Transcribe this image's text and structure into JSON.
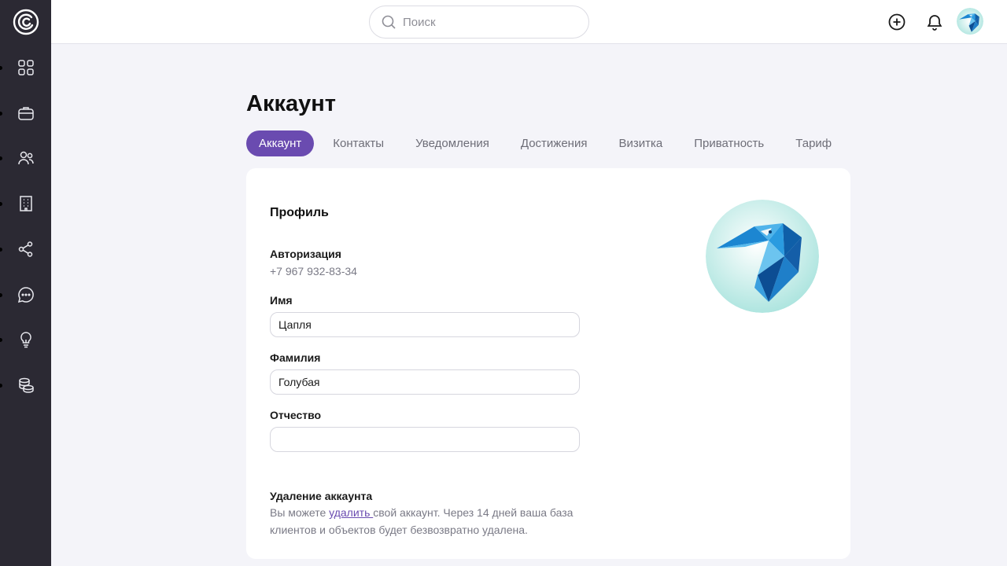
{
  "search": {
    "placeholder": "Поиск"
  },
  "page": {
    "title": "Аккаунт"
  },
  "tabs": [
    {
      "label": "Аккаунт",
      "active": true
    },
    {
      "label": "Контакты"
    },
    {
      "label": "Уведомления"
    },
    {
      "label": "Достижения"
    },
    {
      "label": "Визитка"
    },
    {
      "label": "Приватность"
    },
    {
      "label": "Тариф"
    }
  ],
  "sidebar": {
    "items": [
      {
        "icon": "grid-icon"
      },
      {
        "icon": "briefcase-icon"
      },
      {
        "icon": "users-icon"
      },
      {
        "icon": "building-icon"
      },
      {
        "icon": "share-icon"
      },
      {
        "icon": "chat-icon"
      },
      {
        "icon": "lightbulb-icon"
      },
      {
        "icon": "coins-icon"
      }
    ]
  },
  "profile": {
    "section_title": "Профиль",
    "auth_label": "Авторизация",
    "auth_value": "+7 967 932-83-34",
    "first_name_label": "Имя",
    "first_name_value": "Цапля",
    "last_name_label": "Фамилия",
    "last_name_value": "Голубая",
    "middle_name_label": "Отчество",
    "middle_name_value": ""
  },
  "deletion": {
    "title": "Удаление аккаунта",
    "text_before": "Вы можете ",
    "link": "удалить ",
    "text_after": "свой аккаунт. Через 14 дней ваша база клиентов и объектов будет безвозвратно удалена."
  },
  "colors": {
    "sidebar_bg": "#2b2933",
    "accent": "#6a4bb0",
    "page_bg": "#f4f4f9"
  }
}
